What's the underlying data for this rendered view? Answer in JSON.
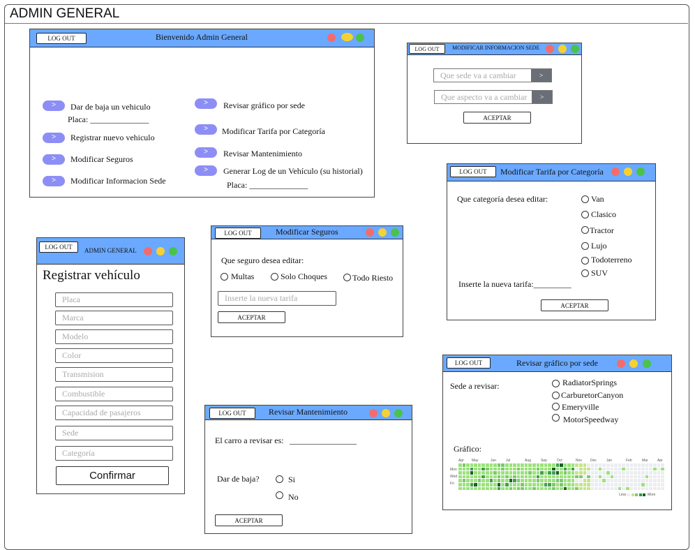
{
  "app_title": "ADMIN GENERAL",
  "colors": {
    "title_bar": "#6aa9ff",
    "pill": "#8d8ef5",
    "close": "#f36c6c",
    "minimize": "#f5d231",
    "maximize": "#4bc24b"
  },
  "common": {
    "logout": "LOG OUT"
  },
  "welcome": {
    "title": "Bienvenido Admin General",
    "pill_label": ">",
    "left_options": [
      "Dar de baja un vehiculo",
      "Registrar nuevo vehiculo",
      "Modificar Seguros",
      "Modificar Informacion Sede"
    ],
    "placa_label": "Placa: ______________",
    "right_options": [
      "Revisar gráfico por sede",
      "Modificar Tarifa por Categoría",
      "Revisar Mantenimiento",
      "Generar Log de un Vehículo (su historial)"
    ],
    "placa_label_right": "Placa: ______________"
  },
  "sede": {
    "title": "MODIFICAR INFORMACION SEDE",
    "select1_placeholder": "Que sede va a cambiar",
    "select2_placeholder": "Que aspecto va a cambiar",
    "arrow": ">",
    "accept": "ACEPTAR"
  },
  "tarifa": {
    "title": "Modificar Tarifa por Categoría",
    "question": "Que categoría desea editar:",
    "options": [
      "Van",
      "Clasico",
      "Tractor",
      "Lujo",
      "Todoterreno",
      "SUV"
    ],
    "new_rate": "Inserte la nueva tarifa:_________",
    "accept": "ACEPTAR"
  },
  "registro": {
    "title": "ADMIN GENERAL",
    "heading": "Registrar vehículo",
    "fields": [
      "Placa",
      "Marca",
      "Modelo",
      "Color",
      "Transmision",
      "Combustible",
      "Capacidad de pasajeros",
      "Sede",
      "Categoría"
    ],
    "confirm": "Confirmar"
  },
  "seguros": {
    "title": "Modificar Seguros",
    "question": "Que seguro desea editar:",
    "options": [
      "Multas",
      "Solo Choques",
      "Todo Riesto"
    ],
    "input_placeholder": "Inserte la nueva tarifa",
    "accept": "ACEPTAR"
  },
  "mantenimiento": {
    "title": "Revisar Mantenimiento",
    "car_label": "El carro a revisar es:",
    "car_line": "________________",
    "dar_baja": "Dar de baja?",
    "options": [
      "Si",
      "No"
    ],
    "accept": "ACEPTAR"
  },
  "grafico": {
    "title": "Revisar gráfico por sede",
    "sede_label": "Sede a revisar:",
    "options": [
      "RadiatorSprings",
      "CarburetorCanyon",
      "Emeryville",
      "MotorSpeedway"
    ],
    "chart_label": "Gráfico:",
    "months": [
      "Apr",
      "May",
      "Jun",
      "Jul",
      "Aug",
      "Sep",
      "Oct",
      "Nov",
      "Dec",
      "Jan",
      "Feb",
      "Mar",
      "Apr"
    ],
    "days": [
      "Mon",
      "Wed",
      "Fri"
    ],
    "legend_less": "Less",
    "legend_more": "More"
  }
}
